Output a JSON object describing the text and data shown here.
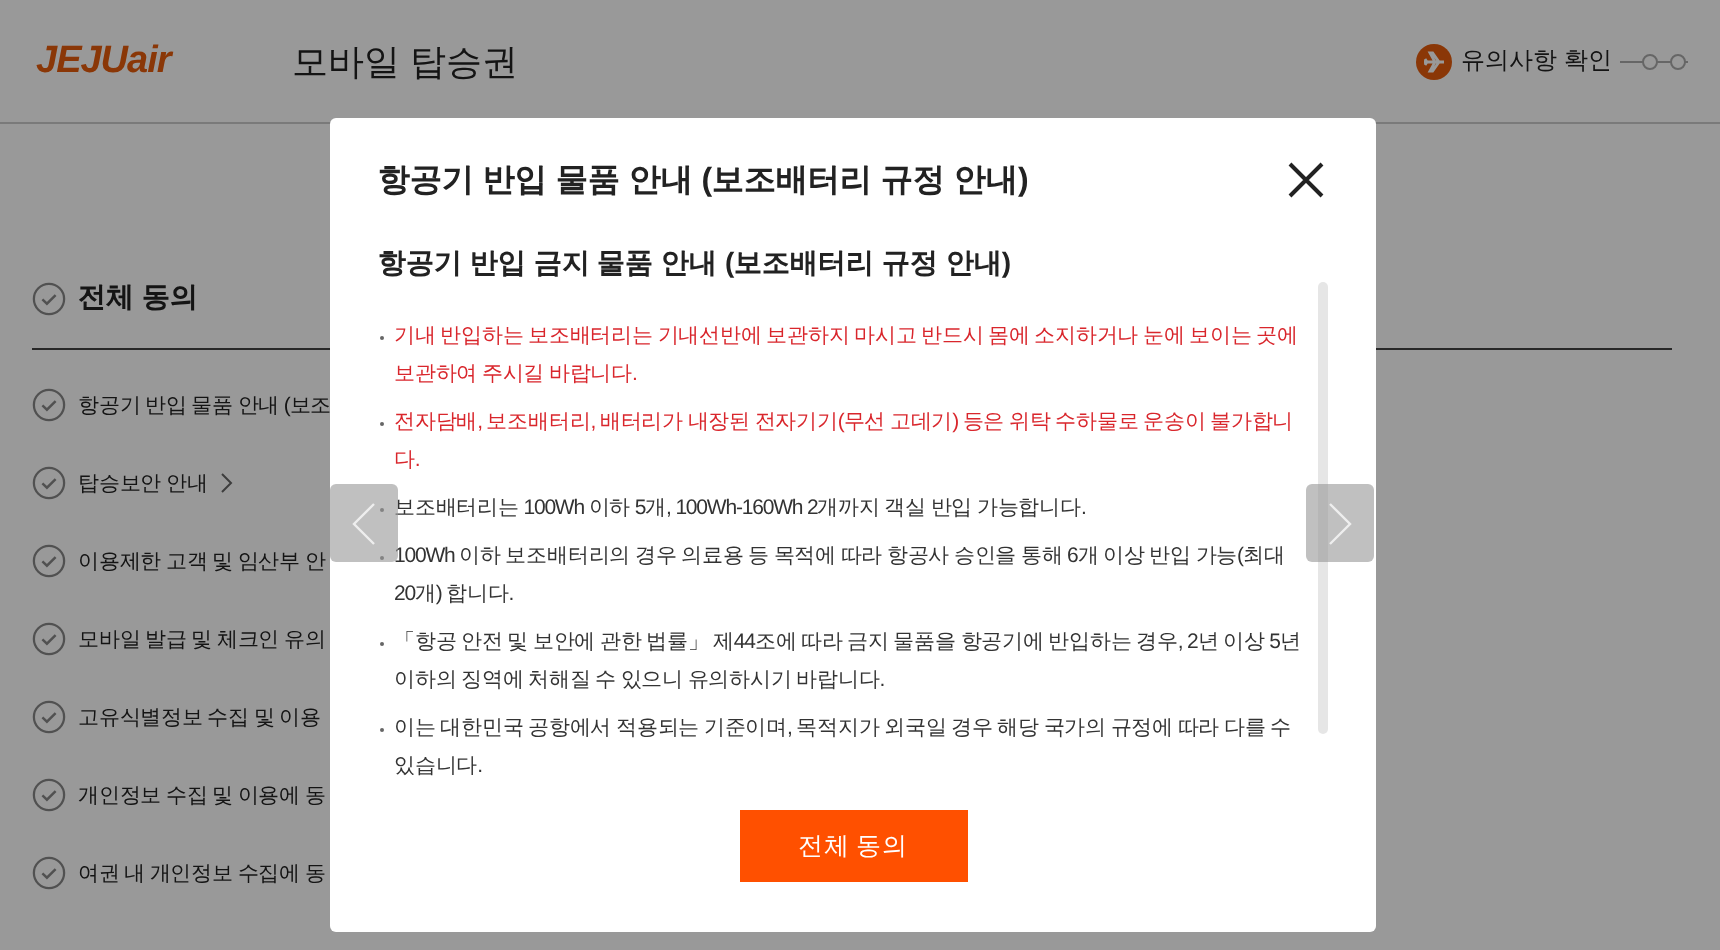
{
  "header": {
    "logo": "JEJUair",
    "title": "모바일 탑승권",
    "notice_link": "유의사항 확인"
  },
  "agreements": {
    "all": {
      "label": "전체 동의",
      "checked": false
    },
    "items": [
      {
        "label": "항공기 반입 물품 안내 (보조",
        "checked": false,
        "has_link": false
      },
      {
        "label": "탑승보안 안내",
        "checked": false,
        "has_link": true
      },
      {
        "label": "이용제한 고객 및 임산부 안",
        "checked": false,
        "has_link": false
      },
      {
        "label": "모바일 발급 및 체크인 유의",
        "checked": false,
        "has_link": false
      },
      {
        "label": "고유식별정보 수집 및 이용",
        "checked": false,
        "has_link": false
      },
      {
        "label": "개인정보 수집 및 이용에 동",
        "checked": false,
        "has_link": false
      },
      {
        "label": "여권 내 개인정보 수집에 동",
        "checked": false,
        "has_link": false
      }
    ]
  },
  "modal": {
    "title": "항공기 반입 물품 안내 (보조배터리 규정 안내)",
    "subtitle": "항공기 반입 금지 물품 안내 (보조배터리 규정 안내)",
    "bullets": [
      {
        "kind": "warning",
        "text": "기내 반입하는 보조배터리는 기내선반에 보관하지 마시고 반드시 몸에 소지하거나 눈에 보이는 곳에 보관하여 주시길 바랍니다."
      },
      {
        "kind": "warning",
        "text": "전자담배, 보조배터리, 배터리가 내장된 전자기기(무선 고데기) 등은 위탁 수하물로 운송이 불가합니다."
      },
      {
        "kind": "normal",
        "text": "보조배터리는 100Wh 이하 5개, 100Wh-160Wh 2개까지 객실 반입 가능합니다."
      },
      {
        "kind": "normal",
        "text": "100Wh 이하 보조배터리의 경우 의료용 등 목적에 따라 항공사 승인을 통해 6개 이상 반입 가능(최대 20개) 합니다."
      },
      {
        "kind": "normal",
        "text": "「항공 안전 및 보안에 관한 법률」 제44조에 따라 금지 물품을 항공기에 반입하는 경우, 2년 이상 5년 이하의 징역에 처해질 수 있으니 유의하시기 바랍니다."
      },
      {
        "kind": "normal",
        "text": "이는 대한민국 공항에서 적용되는 기준이며, 목적지가 외국일 경우 해당 국가의 규정에 따라 다를 수 있습니다."
      }
    ],
    "button": "전체 동의"
  }
}
